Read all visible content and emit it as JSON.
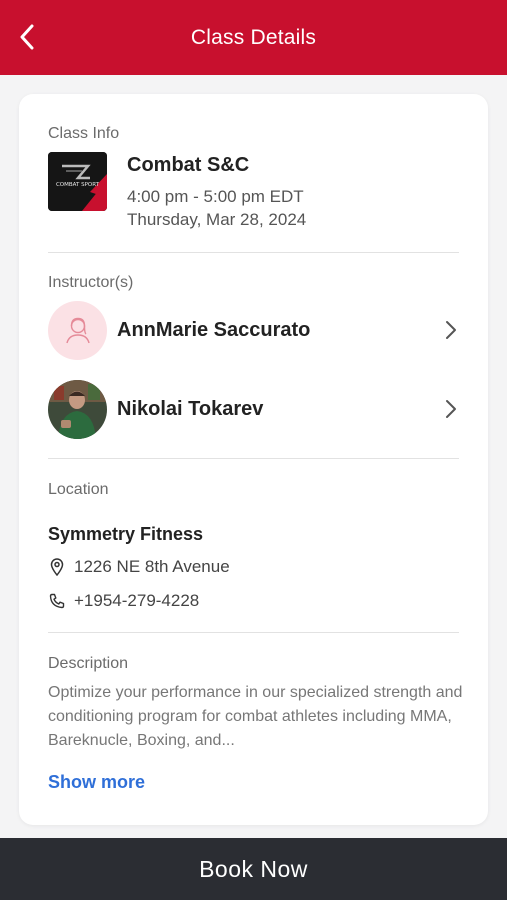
{
  "header": {
    "title": "Class Details",
    "back_icon": "chevron-left-icon"
  },
  "class_info": {
    "section_label": "Class Info",
    "thumbnail_text": "COMBAT SPORT",
    "name": "Combat S&C",
    "time": "4:00 pm - 5:00 pm EDT",
    "date": "Thursday, Mar 28, 2024"
  },
  "instructors": {
    "section_label": "Instructor(s)",
    "items": [
      {
        "name": "AnnMarie Saccurato",
        "avatar": "placeholder-avatar-icon"
      },
      {
        "name": "Nikolai Tokarev",
        "avatar": "photo-avatar"
      }
    ]
  },
  "location": {
    "section_label": "Location",
    "name": "Symmetry Fitness",
    "address": "1226 NE 8th Avenue",
    "phone": "+1954-279-4228"
  },
  "description": {
    "section_label": "Description",
    "text": "Optimize your performance in our specialized strength and conditioning program for combat athletes including MMA, Bareknucle, Boxing, and...",
    "show_more": "Show more"
  },
  "footer": {
    "book_label": "Book Now"
  },
  "colors": {
    "brand_red": "#c8102e",
    "link_blue": "#2f6fd8",
    "footer_dark": "#2b2d33",
    "avatar_pink": "#fbe1e5"
  }
}
